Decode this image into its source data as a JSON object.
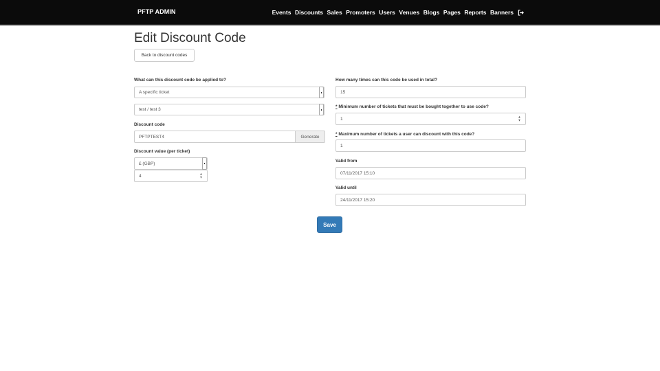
{
  "navbar": {
    "brand": "PFTP ADMIN",
    "items": [
      {
        "label": "Events"
      },
      {
        "label": "Discounts"
      },
      {
        "label": "Sales"
      },
      {
        "label": "Promoters"
      },
      {
        "label": "Users"
      },
      {
        "label": "Venues"
      },
      {
        "label": "Blogs"
      },
      {
        "label": "Pages"
      },
      {
        "label": "Reports"
      },
      {
        "label": "Banners"
      }
    ],
    "logout_icon": "sign-out-icon"
  },
  "page": {
    "title": "Edit Discount Code",
    "back_label": "Back to discount codes"
  },
  "form": {
    "applies_to": {
      "label": "What can this discount code be applied to?",
      "value": "A specific ticket",
      "ticket_value": "test / test 3"
    },
    "code": {
      "label": "Discount code",
      "value": "PFTPTEST4",
      "generate_label": "Generate"
    },
    "discount_value": {
      "label": "Discount value (per ticket)",
      "currency": "£ (GBP)",
      "amount": "4"
    },
    "total_uses": {
      "label": "How many times can this code be used in total?",
      "value": "15"
    },
    "min_tickets": {
      "required_mark": "*",
      "label": " Minimum number of tickets that must be bought together to use code?",
      "value": "1"
    },
    "max_tickets": {
      "required_mark": "*",
      "label": " Maximum number of tickets a user can discount with this code?",
      "value": "1"
    },
    "valid_from": {
      "label": "Valid from",
      "value": "07/11/2017 15:10"
    },
    "valid_until": {
      "label": "Valid until",
      "value": "24/11/2017 15:20"
    },
    "save_label": "Save"
  }
}
